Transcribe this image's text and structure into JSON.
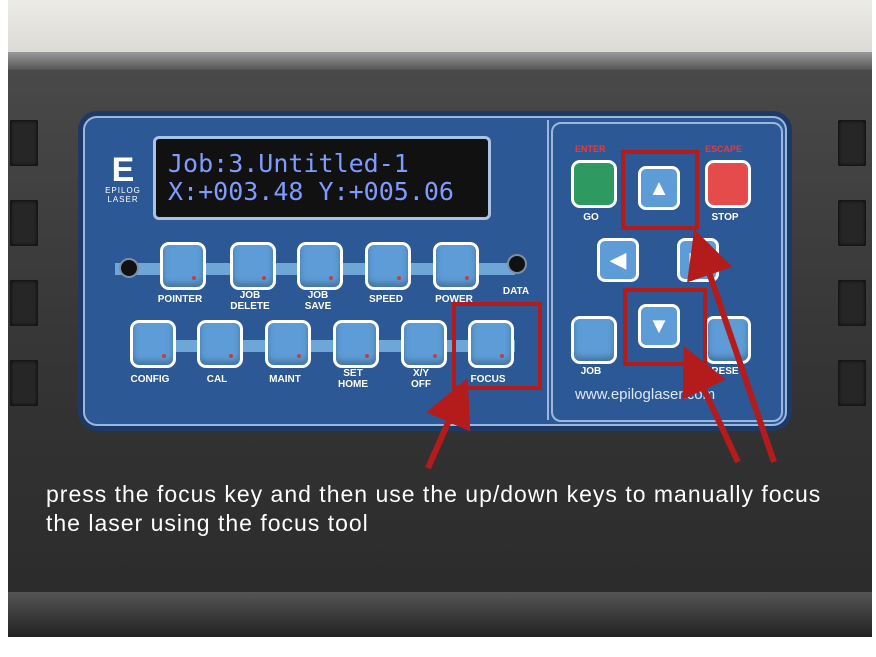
{
  "lcd": {
    "line1": "Job:3.Untitled-1",
    "line2": "X:+003.48 Y:+005.06"
  },
  "logo": {
    "mark": "E",
    "word": "EPILOG LASER"
  },
  "keys_top": [
    "POINTER",
    "JOB\nDELETE",
    "JOB\nSAVE",
    "SPEED",
    "POWER"
  ],
  "keys_bottom": [
    "CONFIG",
    "CAL",
    "MAINT",
    "SET\nHOME",
    "X/Y\nOFF",
    "FOCUS"
  ],
  "data_label": "DATA",
  "right_panel": {
    "enter_label": "ENTER",
    "escape_label": "ESCAPE",
    "go_label": "GO",
    "stop_label": "STOP",
    "job_label": "JOB",
    "reset_label": "RESE",
    "url": "www.epiloglaser.com",
    "up_glyph": "▲",
    "down_glyph": "▼",
    "left_glyph": "◀",
    "right_glyph": "▶"
  },
  "caption": "press the focus key and then use the up/down keys to manually focus the laser using the focus tool",
  "colors": {
    "panel": "#2d5896",
    "key": "#5d9cd6",
    "go_key": "#2e9a62",
    "stop_key": "#e54b4b",
    "highlight": "#b41b1b"
  }
}
